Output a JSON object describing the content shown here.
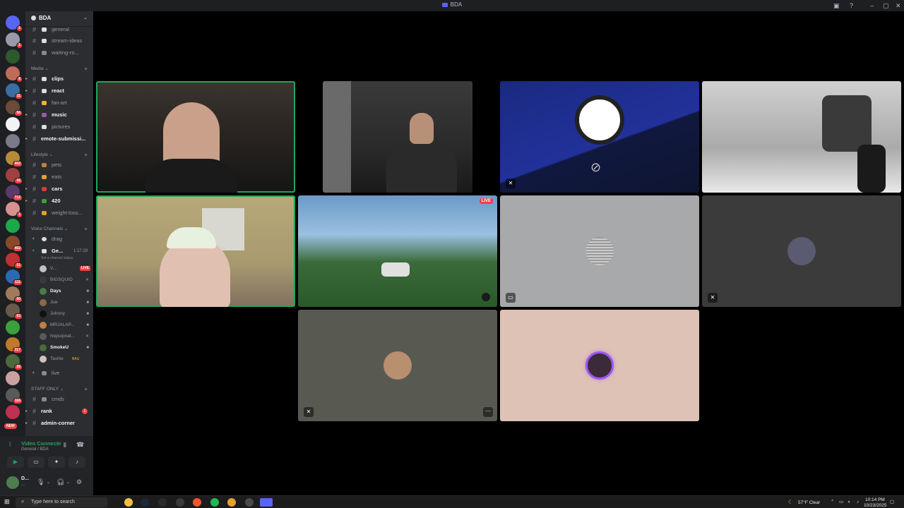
{
  "window": {
    "title": "BDA"
  },
  "server": {
    "name": "BDA"
  },
  "channels_top": [
    {
      "name": "general",
      "unread": false
    },
    {
      "name": "stream-ideas",
      "unread": false
    },
    {
      "name": "waiting-ro...",
      "unread": false
    }
  ],
  "categories": {
    "media": "Media",
    "lifestyle": "Lifestyle",
    "voice": "Voice Channels",
    "staff": "STAFF ONLY"
  },
  "media_channels": [
    {
      "name": "clips",
      "unread": true
    },
    {
      "name": "react",
      "unread": true
    },
    {
      "name": "fan-art",
      "unread": false
    },
    {
      "name": "music",
      "unread": true
    },
    {
      "name": "pictures",
      "unread": false
    },
    {
      "name": "emote-submissi...",
      "unread": true
    }
  ],
  "lifestyle_channels": [
    {
      "name": "pets",
      "unread": false
    },
    {
      "name": "eats",
      "unread": false
    },
    {
      "name": "cars",
      "unread": true
    },
    {
      "name": "420",
      "unread": true
    },
    {
      "name": "weight-loss...",
      "unread": false
    }
  ],
  "voice_channels": {
    "drag": "drag",
    "general": "Ge...",
    "general_timer": "1:17:29",
    "status_hint": "Set a channel status",
    "live_channel": "live"
  },
  "voice_users": [
    {
      "name": "V...",
      "live": true,
      "highlight": false
    },
    {
      "name": "BIGSQUID",
      "live": false,
      "highlight": false
    },
    {
      "name": "Days",
      "live": false,
      "highlight": true
    },
    {
      "name": "Joe",
      "live": false,
      "highlight": false
    },
    {
      "name": "Johnny",
      "live": false,
      "highlight": false
    },
    {
      "name": "MRJALAP...",
      "live": false,
      "highlight": false
    },
    {
      "name": "Nopuipnat...",
      "live": false,
      "highlight": false
    },
    {
      "name": "SmokeU",
      "live": false,
      "highlight": true
    },
    {
      "name": "Tashie",
      "live": false,
      "highlight": false,
      "tag": "BAU"
    }
  ],
  "staff_channels": [
    {
      "name": "cmds",
      "unread": false
    },
    {
      "name": "rank",
      "unread": true,
      "badge": "1"
    },
    {
      "name": "admin-corner",
      "unread": true
    }
  ],
  "server_badges": [
    "1",
    "1",
    "8",
    "11",
    "56",
    "402",
    "42",
    "712",
    "1",
    "402",
    "51",
    "111",
    "60",
    "63",
    "317",
    "26",
    "116",
    "NEW"
  ],
  "voice_connection": {
    "status": "Video Connecte",
    "location": "General / BDA"
  },
  "user": {
    "name": "D...",
    "status": "..."
  },
  "tiles": [
    {
      "label": "live",
      "live_label": "LIVE"
    }
  ],
  "taskbar": {
    "search_placeholder": "Type here to search",
    "weather": "57°F Clear",
    "time": "10:14 PM",
    "date": "10/23/2025"
  },
  "colors": {
    "accent": "#5865f2",
    "speaking": "#23a55a",
    "live": "#ed4245"
  }
}
